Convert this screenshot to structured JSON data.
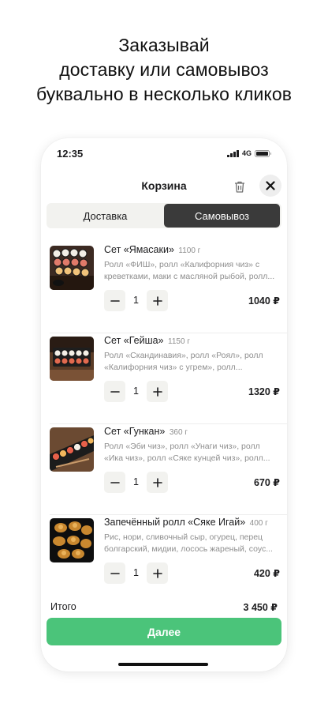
{
  "headline": {
    "line1": "Заказывай",
    "line2": "доставку или самовывоз",
    "line3": "буквально в несколько кликов"
  },
  "status_bar": {
    "time": "12:35",
    "network": "4G"
  },
  "header": {
    "title": "Корзина"
  },
  "tabs": [
    {
      "label": "Доставка",
      "selected": false
    },
    {
      "label": "Самовывоз",
      "selected": true
    }
  ],
  "cart": {
    "items": [
      {
        "name": "Сет «Ямасаки»",
        "weight": "1100 г",
        "description": "Ролл «ФИШ», ролл «Калифорния чиз» с креветками, маки с масляной рыбой, ролл...",
        "quantity": "1",
        "price": "1040 ₽"
      },
      {
        "name": "Сет «Гейша»",
        "weight": "1150 г",
        "description": "Ролл «Скандинавия», ролл «Роял», ролл «Калифорния чиз» с угрем», ролл...",
        "quantity": "1",
        "price": "1320 ₽"
      },
      {
        "name": "Сет «Гункан»",
        "weight": "360 г",
        "description": "Ролл «Эби чиз», ролл «Унаги чиз», ролл «Ика чиз», ролл «Сяке кунцей чиз», ролл...",
        "quantity": "1",
        "price": "670 ₽"
      },
      {
        "name": "Запечённый ролл «Сяке Игай»",
        "weight": "400 г",
        "description": "Рис, нори, сливочный сыр, огурец, перец болгарский, мидии, лосось жареный, соус...",
        "quantity": "1",
        "price": "420 ₽"
      }
    ]
  },
  "footer": {
    "total_label": "Итого",
    "total_value": "3 450 ₽",
    "next_label": "Далее"
  },
  "colors": {
    "accent_green": "#4bc47a",
    "selected_tab": "#3a3a3a",
    "stepper_bg": "#f2f2ef"
  },
  "icons": {
    "delete": "trash-icon",
    "close": "close-icon",
    "minus": "minus-icon",
    "plus": "plus-icon"
  }
}
